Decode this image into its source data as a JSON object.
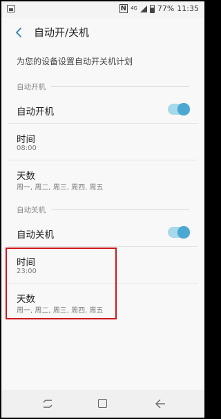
{
  "status_bar": {
    "battery": "77%",
    "time": "11:35",
    "network": "4G"
  },
  "header": {
    "title": "自动开/关机"
  },
  "description": "为您的设备设置自动开关机计划",
  "power_on": {
    "section_label": "自动开机",
    "toggle_label": "自动开机",
    "toggle_on": true,
    "time_label": "时间",
    "time_value": "08:00",
    "days_label": "天数",
    "days_value": "周一, 周二, 周三, 周四, 周五"
  },
  "power_off": {
    "section_label": "自动关机",
    "toggle_label": "自动关机",
    "toggle_on": true,
    "time_label": "时间",
    "time_value": "23:00",
    "days_label": "天数",
    "days_value": "周一, 周二, 周三, 周四, 周五"
  },
  "colors": {
    "accent": "#4aa8d2",
    "highlight": "#d0161b"
  },
  "nav": {
    "icons": [
      "recent-apps-icon",
      "home-icon",
      "back-icon"
    ]
  }
}
